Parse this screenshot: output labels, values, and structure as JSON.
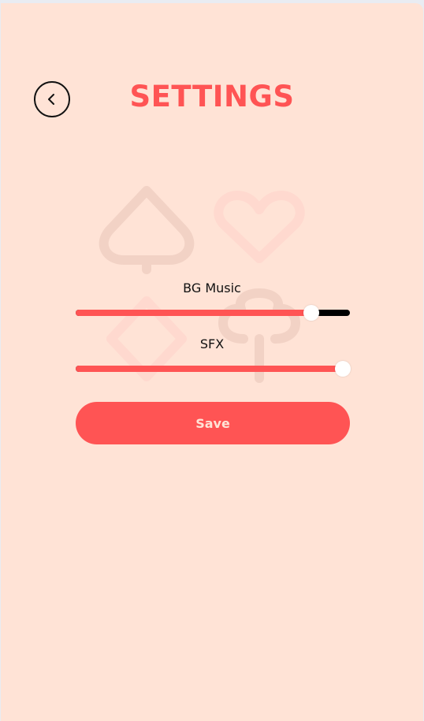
{
  "header": {
    "title": "SETTINGS",
    "back_icon": "chevron-left-icon"
  },
  "settings": {
    "bg_music": {
      "label": "BG Music",
      "level": 0.86
    },
    "sfx": {
      "label": "SFX",
      "level": 0.975
    }
  },
  "actions": {
    "save_label": "Save"
  },
  "decorations": [
    "spade-icon",
    "heart-icon",
    "diamond-icon",
    "club-icon"
  ],
  "colors": {
    "background": "#ffe3d6",
    "accent": "#ff5454",
    "track": "#000000",
    "thumb": "#ffffff"
  }
}
